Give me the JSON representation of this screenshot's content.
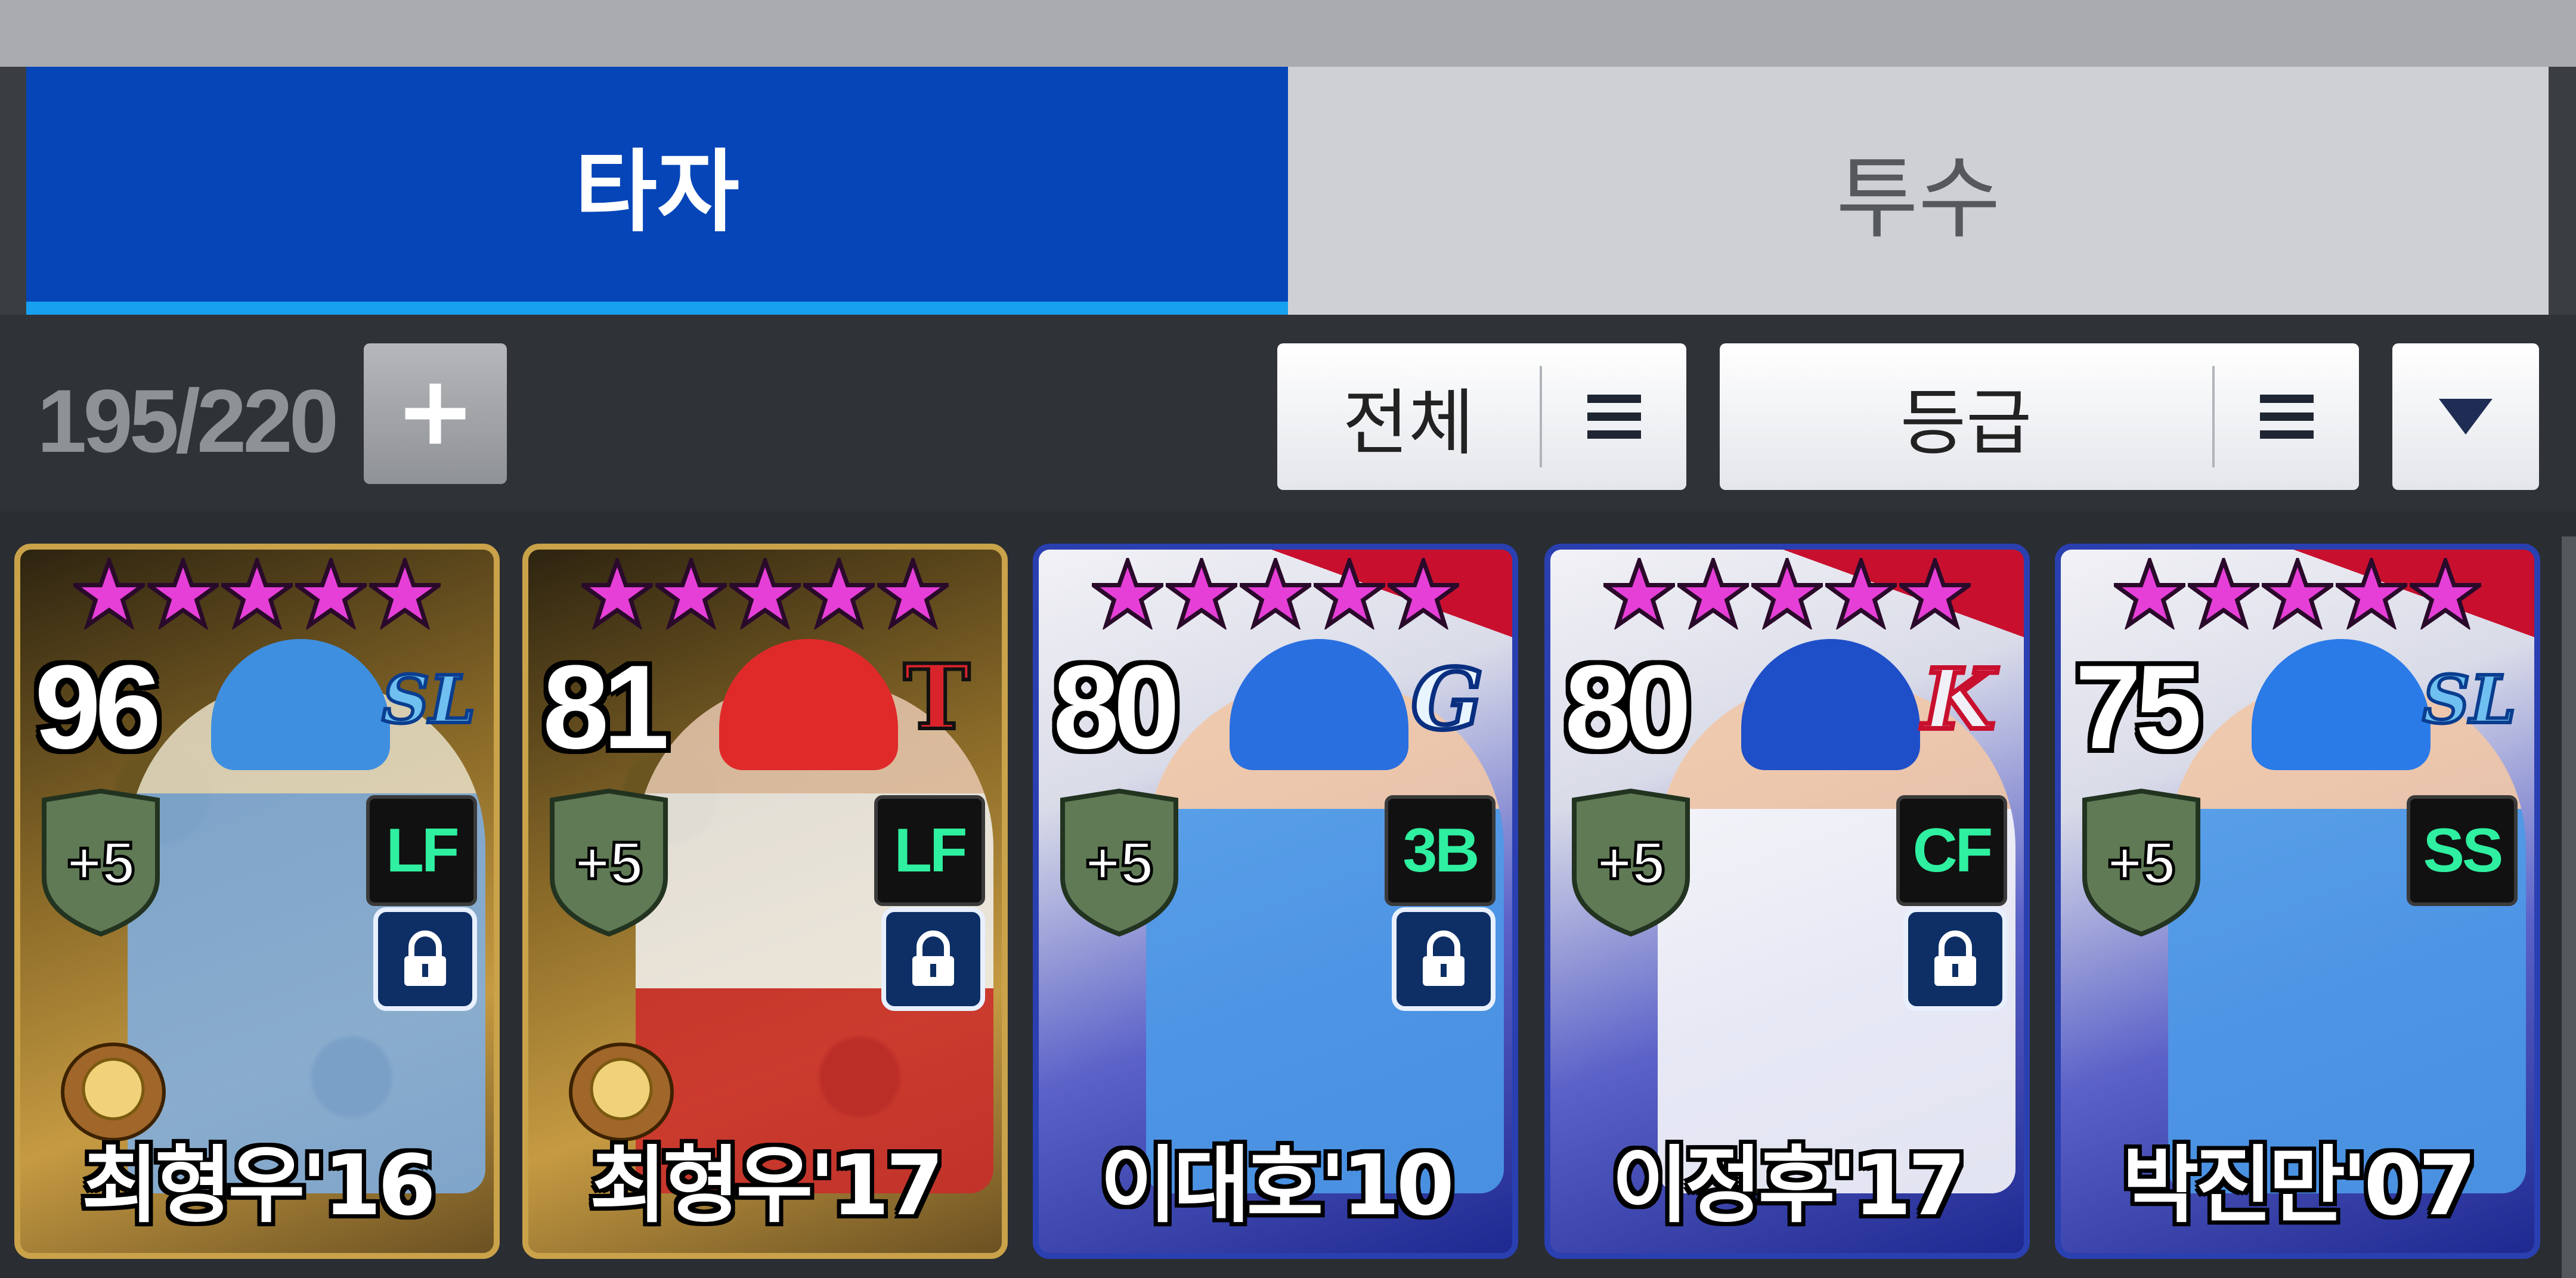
{
  "tabs": [
    {
      "label": "타자",
      "active": true
    },
    {
      "label": "투수",
      "active": false
    }
  ],
  "toolbar": {
    "count": "195/220",
    "filter_all_label": "전체",
    "filter_grade_label": "등급"
  },
  "colors": {
    "active_tab": "#0645b8",
    "active_tab_underline": "#18a0f0",
    "star": "#e63fd8",
    "position_text": "#2ff0a0"
  },
  "cards": [
    {
      "overall": "96",
      "team": "SL",
      "enhance": "+5",
      "position": "LF",
      "name": "최형우'16",
      "stars": 5,
      "locked": true,
      "style": "gold",
      "glove": true
    },
    {
      "overall": "81",
      "team": "T",
      "enhance": "+5",
      "position": "LF",
      "name": "최형우'17",
      "stars": 5,
      "locked": true,
      "style": "gold",
      "glove": true
    },
    {
      "overall": "80",
      "team": "G",
      "enhance": "+5",
      "position": "3B",
      "name": "이대호'10",
      "stars": 5,
      "locked": true,
      "style": "blue",
      "glove": false
    },
    {
      "overall": "80",
      "team": "K",
      "enhance": "+5",
      "position": "CF",
      "name": "이정후'17",
      "stars": 5,
      "locked": true,
      "style": "blue",
      "glove": false
    },
    {
      "overall": "75",
      "team": "SL",
      "enhance": "+5",
      "position": "SS",
      "name": "박진만'07",
      "stars": 5,
      "locked": false,
      "style": "blue",
      "glove": false
    }
  ]
}
